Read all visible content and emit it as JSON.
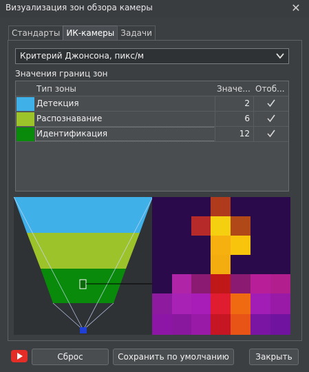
{
  "window": {
    "title": "Визуализация зон обзора камеры",
    "close_glyph": "✕"
  },
  "tabs": [
    {
      "label": "Стандарты",
      "active": false
    },
    {
      "label": "ИК-камеры",
      "active": true
    },
    {
      "label": "Задачи",
      "active": false
    }
  ],
  "criterion": {
    "selected": "Критерий Джонсона, пикс/м"
  },
  "zones_section": {
    "label": "Значения границ зон"
  },
  "table": {
    "headers": {
      "type": "Тип зоны",
      "value": "Значе...",
      "show": "Отоб..."
    },
    "rows": [
      {
        "name": "Детекция",
        "value": "2",
        "color": "#3fb0e8",
        "shown": true
      },
      {
        "name": "Распознавание",
        "value": "6",
        "color": "#9dc32a",
        "shown": true
      },
      {
        "name": "Идентификация",
        "value": "12",
        "color": "#0a8a0a",
        "shown": true
      }
    ]
  },
  "buttons": {
    "reset": "Сброс",
    "save_default": "Сохранить по умолчанию",
    "close": "Закрыть"
  },
  "icons": {
    "youtube": "youtube-icon",
    "close": "close-icon",
    "dropdown": "chevron-down-icon",
    "check": "check-icon",
    "camera": "camera-icon",
    "person": "person-icon"
  },
  "colors": {
    "detection": "#3fb0e8",
    "recognition": "#9dc32a",
    "identification": "#0a8a0a",
    "camera": "#1f3fd6"
  }
}
